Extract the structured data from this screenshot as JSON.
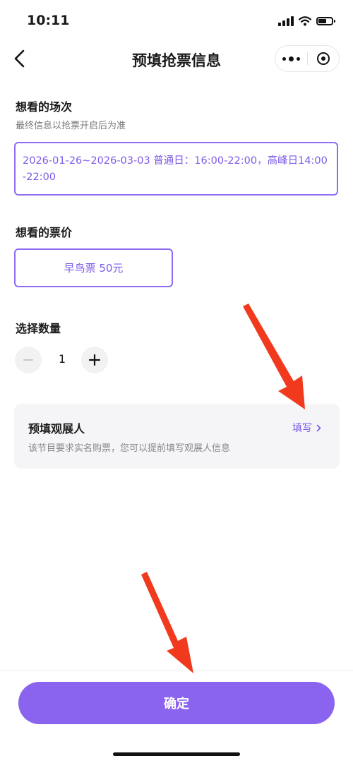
{
  "status_bar": {
    "time": "10:11"
  },
  "header": {
    "title": "预填抢票信息"
  },
  "session": {
    "title": "想看的场次",
    "subtitle": "最终信息以抢票开启后为准",
    "value": "2026-01-26~2026-03-03 普通日：16:00-22:00，高峰日14:00-22:00"
  },
  "price": {
    "title": "想看的票价",
    "value": "早鸟票 50元"
  },
  "quantity": {
    "title": "选择数量",
    "value": "1"
  },
  "visitor": {
    "title": "预填观展人",
    "subtitle": "该节目要求实名购票，您可以提前填写观展人信息",
    "link_label": "填写"
  },
  "footer": {
    "confirm_label": "确定"
  },
  "colors": {
    "accent": "#8a63ef",
    "annotation_arrow": "#f13a1d"
  }
}
